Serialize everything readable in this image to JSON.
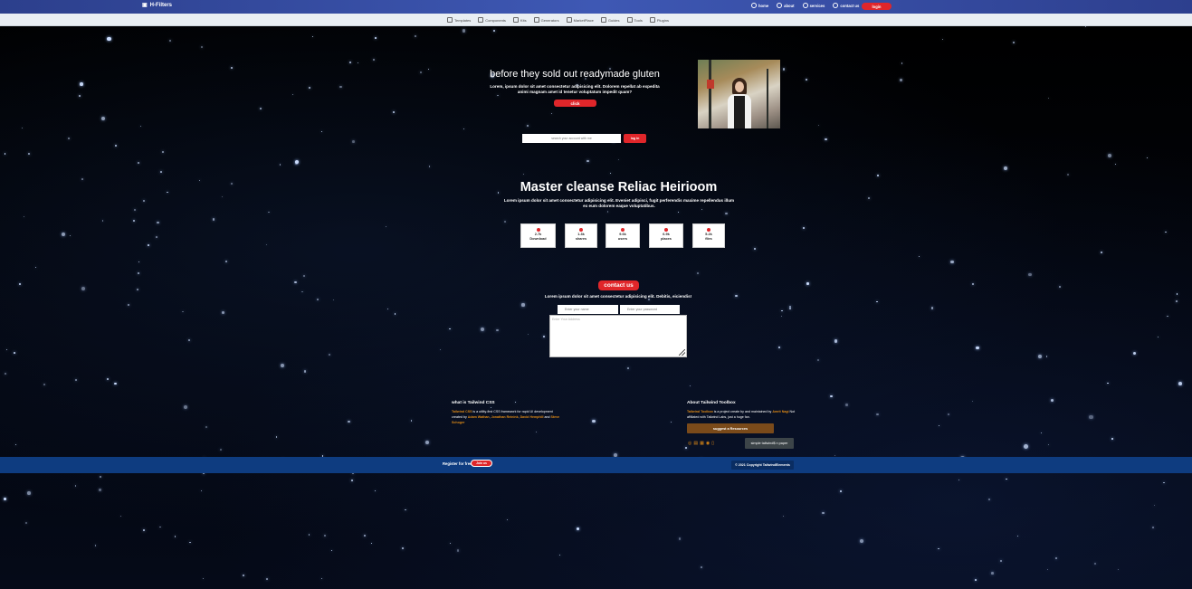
{
  "header": {
    "brand": "H-Filters",
    "nav": [
      {
        "label": "home",
        "icon": "home-icon"
      },
      {
        "label": "about",
        "icon": "info-icon"
      },
      {
        "label": "services",
        "icon": "services-icon"
      },
      {
        "label": "contact us",
        "icon": "phone-icon"
      }
    ],
    "login_label": "login"
  },
  "subnav": [
    {
      "label": "Templates",
      "icon": "template-icon"
    },
    {
      "label": "Components",
      "icon": "components-icon"
    },
    {
      "label": "Kits",
      "icon": "kits-icon"
    },
    {
      "label": "Generators",
      "icon": "generator-icon"
    },
    {
      "label": "MarketPlace",
      "icon": "cart-icon"
    },
    {
      "label": "Guides",
      "icon": "guide-icon"
    },
    {
      "label": "Tools",
      "icon": "tools-icon"
    },
    {
      "label": "Plugins",
      "icon": "plugin-icon"
    }
  ],
  "hero": {
    "title": "before they sold out readymade gluten",
    "description": "Lorem, ipsum dolor sit amet consectetur adipisicing elit. Dolorem repellat ab expedita animi magnam amet id tenetur voluptatum impedit quam?",
    "button_label": "click",
    "subscribe_placeholder": "search your account with me",
    "subscribe_button": "log in"
  },
  "stats": {
    "title": "Master cleanse Reliac Heirioom",
    "description": "Lorem ipsum dolor sit amet consectetur adipisicing elit. Eveniet adipisci, fugit perferendis maxime repellendus illum ex eum dolorem eaque voluptatibus.",
    "items": [
      {
        "value": "2.7k",
        "label": "Download",
        "icon": "download-icon"
      },
      {
        "value": "1.3k",
        "label": "shares",
        "icon": "share-icon"
      },
      {
        "value": "9.6k",
        "label": "users",
        "icon": "users-icon"
      },
      {
        "value": "6.9k",
        "label": "places",
        "icon": "place-icon"
      },
      {
        "value": "5.2k",
        "label": "files",
        "icon": "file-icon"
      }
    ]
  },
  "contact": {
    "button_label": "contact us",
    "description": "Lorem ipsum dolor sit amet consectetur adipisicing elit. Debitis, eiciendis!",
    "name_placeholder": "Enter your name",
    "password_placeholder": "Enter your password",
    "address_placeholder": "Enter Your Address"
  },
  "footer": {
    "left_title": "what is Tailwind CSS",
    "left_link": "Tailwind CSS",
    "left_text": " is a utility-first CSS framework for rapid UI development created by ",
    "authors": [
      "Adam Wathan",
      "Jonathan Reinink",
      "David Hemphill",
      "Steve Schoger"
    ],
    "sep1": ", ",
    "sep2": ", ",
    "sep3": " and ",
    "right_title": "About Tailwind Toolbox",
    "right_link": "Tailwind Toolbox",
    "right_text1": " is a project create by and maintained by ",
    "right_author": "Amrit Nagi",
    "right_text2": " Not affiliated with Tailwind Labs, just a huge fan.",
    "suggest_label": "suggest a Resources",
    "icons": [
      "github-icon",
      "twitter-icon",
      "calendar-icon",
      "gift-icon",
      "cart-icon"
    ],
    "tailwind_label": "simple tailwind$ n paper"
  },
  "bottom": {
    "register_text": "Register for free",
    "join_label": "Join us",
    "copyright": "© 2021 Copyright TailwindElements"
  },
  "colors": {
    "accent_red": "#e0262a",
    "header_blue": "#3e58b4",
    "bottom_blue": "#0e3c80",
    "orange": "#e08b16"
  }
}
